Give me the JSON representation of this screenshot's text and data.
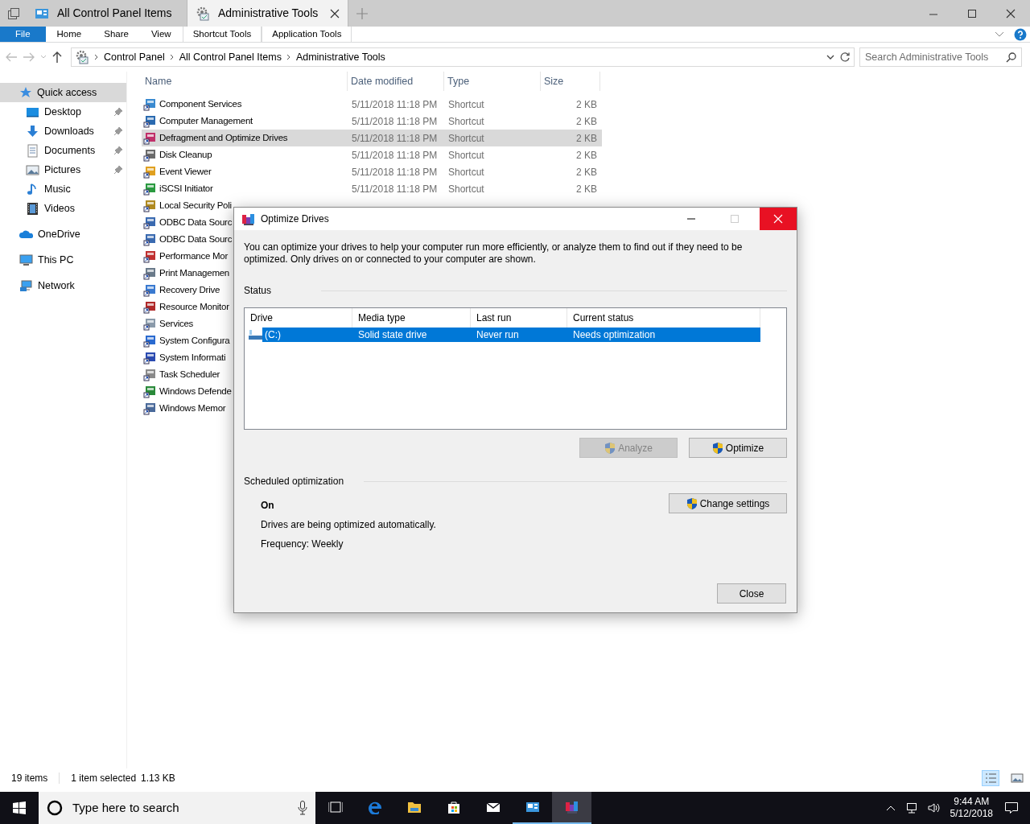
{
  "window": {
    "tabs": [
      {
        "label": "All Control Panel Items",
        "selected": false
      },
      {
        "label": "Administrative Tools",
        "selected": true
      }
    ]
  },
  "ribbon": {
    "tabs": [
      {
        "label": "File",
        "kind": "file"
      },
      {
        "label": "Home",
        "kind": "plain"
      },
      {
        "label": "Share",
        "kind": "plain"
      },
      {
        "label": "View",
        "kind": "plain"
      },
      {
        "label": "Shortcut Tools",
        "kind": "context"
      },
      {
        "label": "Application Tools",
        "kind": "context"
      }
    ]
  },
  "address": {
    "crumbs": [
      "Control Panel",
      "All Control Panel Items",
      "Administrative Tools"
    ]
  },
  "search": {
    "placeholder": "Search Administrative Tools"
  },
  "sidebar": {
    "items": [
      {
        "label": "Quick access",
        "selected": true,
        "children": [
          {
            "label": "Desktop",
            "pinned": true
          },
          {
            "label": "Downloads",
            "pinned": true
          },
          {
            "label": "Documents",
            "pinned": true
          },
          {
            "label": "Pictures",
            "pinned": true
          },
          {
            "label": "Music",
            "pinned": false
          },
          {
            "label": "Videos",
            "pinned": false
          }
        ]
      },
      {
        "label": "OneDrive",
        "selected": false
      },
      {
        "label": "This PC",
        "selected": false
      },
      {
        "label": "Network",
        "selected": false
      }
    ]
  },
  "files": {
    "columns": [
      "Name",
      "Date modified",
      "Type",
      "Size"
    ],
    "rows": [
      {
        "name": "Component Services",
        "date": "5/11/2018 11:18 PM",
        "type": "Shortcut",
        "size": "2 KB",
        "selected": false
      },
      {
        "name": "Computer Management",
        "date": "5/11/2018 11:18 PM",
        "type": "Shortcut",
        "size": "2 KB",
        "selected": false
      },
      {
        "name": "Defragment and Optimize Drives",
        "date": "5/11/2018 11:18 PM",
        "type": "Shortcut",
        "size": "2 KB",
        "selected": true
      },
      {
        "name": "Disk Cleanup",
        "date": "5/11/2018 11:18 PM",
        "type": "Shortcut",
        "size": "2 KB",
        "selected": false
      },
      {
        "name": "Event Viewer",
        "date": "5/11/2018 11:18 PM",
        "type": "Shortcut",
        "size": "2 KB",
        "selected": false
      },
      {
        "name": "iSCSI Initiator",
        "date": "5/11/2018 11:18 PM",
        "type": "Shortcut",
        "size": "2 KB",
        "selected": false
      },
      {
        "name": "Local Security Poli",
        "selected": false
      },
      {
        "name": "ODBC Data Sourc",
        "selected": false
      },
      {
        "name": "ODBC Data Sourc",
        "selected": false
      },
      {
        "name": "Performance Mor",
        "selected": false
      },
      {
        "name": "Print Managemen",
        "selected": false
      },
      {
        "name": "Recovery Drive",
        "selected": false
      },
      {
        "name": "Resource Monitor",
        "selected": false
      },
      {
        "name": "Services",
        "selected": false
      },
      {
        "name": "System Configura",
        "selected": false
      },
      {
        "name": "System Informati",
        "selected": false
      },
      {
        "name": "Task Scheduler",
        "selected": false
      },
      {
        "name": "Windows Defende",
        "selected": false
      },
      {
        "name": "Windows Memor",
        "selected": false
      }
    ]
  },
  "status_bar": {
    "count": "19 items",
    "selection": "1 item selected",
    "size": "1.13 KB"
  },
  "dialog": {
    "title": "Optimize Drives",
    "maximize_disabled": true,
    "intro": "You can optimize your drives to help your computer run more efficiently, or analyze them to find out if they need to be optimized. Only drives on or connected to your computer are shown.",
    "status_label": "Status",
    "drives": {
      "columns": [
        "Drive",
        "Media type",
        "Last run",
        "Current status"
      ],
      "rows": [
        {
          "drive": "(C:)",
          "media_type": "Solid state drive",
          "last_run": "Never run",
          "current_status": "Needs optimization",
          "selected": true
        }
      ]
    },
    "buttons": [
      {
        "label": "Analyze",
        "disabled": true
      },
      {
        "label": "Optimize",
        "disabled": false
      }
    ],
    "schedule": {
      "label": "Scheduled optimization",
      "state": "On",
      "description": "Drives are being optimized automatically.",
      "frequency": "Frequency: Weekly",
      "button": "Change settings"
    },
    "close_button": "Close"
  },
  "taskbar": {
    "search_placeholder": "Type here to search",
    "time": "9:44 AM",
    "date": "5/12/2018",
    "apps": [
      {
        "open": false,
        "selected": false
      },
      {
        "open": false,
        "selected": false
      },
      {
        "open": false,
        "selected": false
      },
      {
        "open": false,
        "selected": false
      },
      {
        "open": false,
        "selected": false
      },
      {
        "open": true,
        "selected": false
      },
      {
        "open": true,
        "selected": true
      }
    ]
  }
}
